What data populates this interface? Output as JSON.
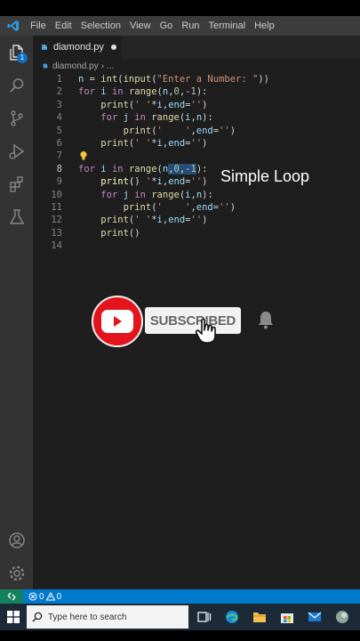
{
  "menubar": {
    "items": [
      "File",
      "Edit",
      "Selection",
      "View",
      "Go",
      "Run",
      "Terminal",
      "Help"
    ]
  },
  "activity": {
    "explorer_badge": "1",
    "icons": [
      "files-icon",
      "search-icon",
      "source-control-icon",
      "run-debug-icon",
      "extensions-icon",
      "testing-icon",
      "account-icon",
      "settings-gear-icon"
    ]
  },
  "tab": {
    "label": "diamond.py"
  },
  "breadcrumb": {
    "file": "diamond.py",
    "more": "..."
  },
  "code": {
    "lines": [
      "1",
      "2",
      "3",
      "4",
      "5",
      "6",
      "7",
      "8",
      "9",
      "10",
      "11",
      "12",
      "13",
      "14"
    ],
    "current_line": "8"
  },
  "caption": "Simple Loop",
  "subscribe": {
    "label": "SUBSCRIBED"
  },
  "status": {
    "errors": "0",
    "warnings": "0"
  },
  "taskbar": {
    "search_placeholder": "Type here to search"
  },
  "colors": {
    "accent": "#007acc",
    "keyword": "#c586c0",
    "function": "#dcdcaa",
    "string": "#ce9178",
    "number": "#b5cea8",
    "youtube_red": "#e3141b"
  }
}
